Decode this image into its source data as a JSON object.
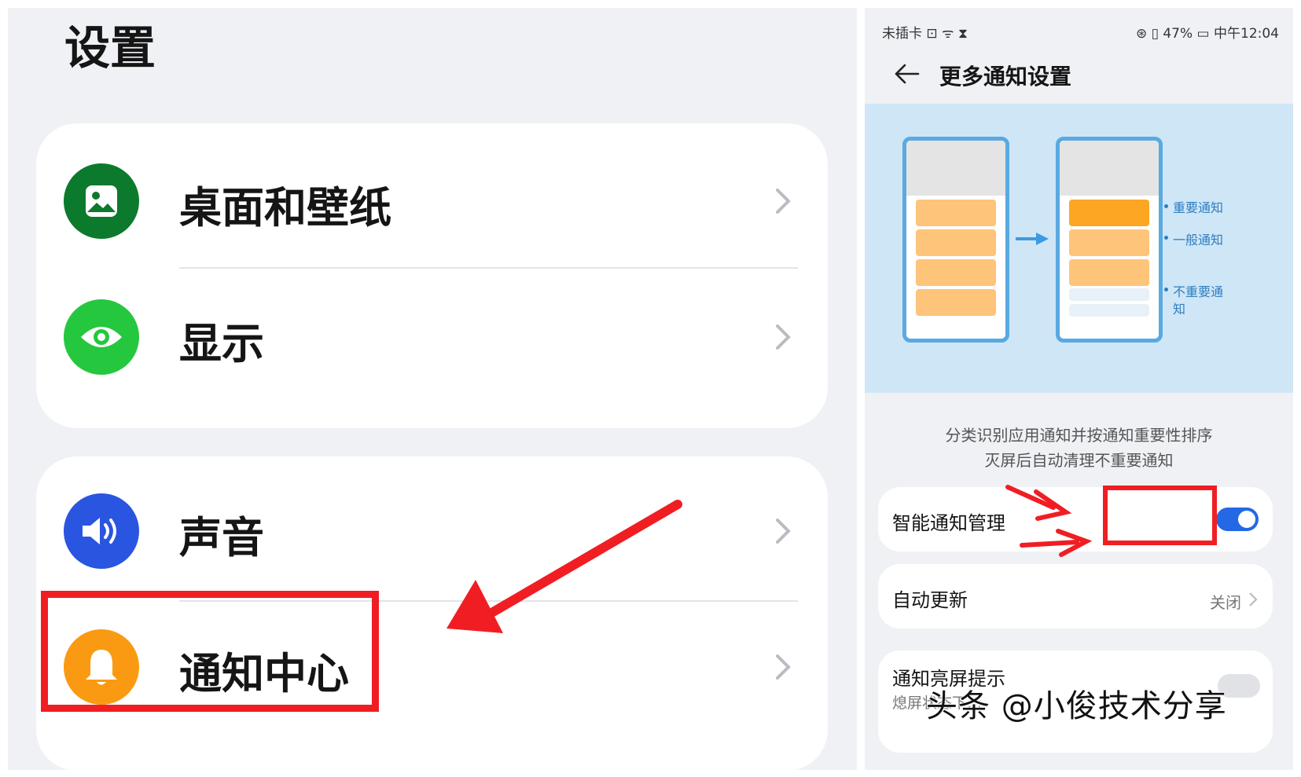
{
  "left": {
    "title": "设置",
    "card1": [
      {
        "label": "桌面和壁纸",
        "icon": "wallpaper-icon",
        "color": "#0b7a2c"
      },
      {
        "label": "显示",
        "icon": "eye-icon",
        "color": "#25c73f"
      }
    ],
    "card2": [
      {
        "label": "声音",
        "icon": "speaker-icon",
        "color": "#2a55e0"
      },
      {
        "label": "通知中心",
        "icon": "bell-icon",
        "color": "#fa9a13"
      }
    ]
  },
  "right": {
    "status_left": "未插卡 ⊡ ᯤ ⧗",
    "status_right": "⊛ ▯ 47% ▭ 中午12:04",
    "title": "更多通知设置",
    "illustration": {
      "labels": [
        "重要通知",
        "一般通知",
        "不重要通",
        "知"
      ]
    },
    "description": [
      "分类识别应用通知并按通知重要性排序",
      "灭屏后自动清理不重要通知"
    ],
    "rows": {
      "smart": {
        "label": "智能通知管理",
        "toggle_on": true
      },
      "auto_update": {
        "label": "自动更新",
        "value": "关闭"
      },
      "screen_wake": {
        "label": "通知亮屏提示",
        "sub": "熄屏状态下…"
      }
    }
  },
  "watermark": "头条 @小俊技术分享",
  "colors": {
    "annotation": "#f01e23",
    "accent": "#2468e6"
  }
}
